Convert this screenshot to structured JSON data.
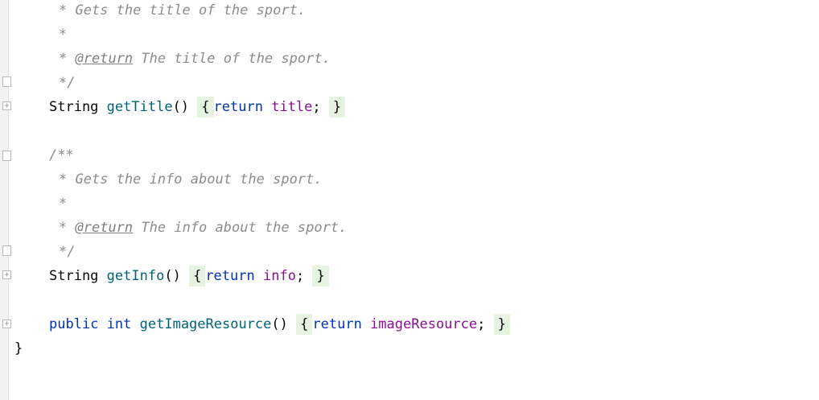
{
  "editor": {
    "lines": {
      "doc1_desc": "* Gets the title of the sport.",
      "doc1_blank": "*",
      "doc1_return_star": "*",
      "doc1_return_tag": "@return",
      "doc1_return_text": "The title of the sport.",
      "doc1_end": "*/",
      "title_type": "String",
      "title_method": "getTitle",
      "title_parens": "()",
      "title_open": "{",
      "title_return": "return",
      "title_field": "title",
      "title_semi": ";",
      "title_close": "}",
      "doc2_start": "/**",
      "doc2_desc": "* Gets the info about the sport.",
      "doc2_blank": "*",
      "doc2_return_star": "*",
      "doc2_return_tag": "@return",
      "doc2_return_text": "The info about the sport.",
      "doc2_end": "*/",
      "info_type": "String",
      "info_method": "getInfo",
      "info_parens": "()",
      "info_open": "{",
      "info_return": "return",
      "info_field": "info",
      "info_semi": ";",
      "info_close": "}",
      "img_public": "public",
      "img_int": "int",
      "img_method": "getImageResource",
      "img_parens": "()",
      "img_open": "{",
      "img_return": "return",
      "img_field": "imageResource",
      "img_semi": ";",
      "img_close": "}",
      "class_close": "}"
    },
    "fold_icons": {
      "expand": "+",
      "collapse": "-"
    }
  }
}
